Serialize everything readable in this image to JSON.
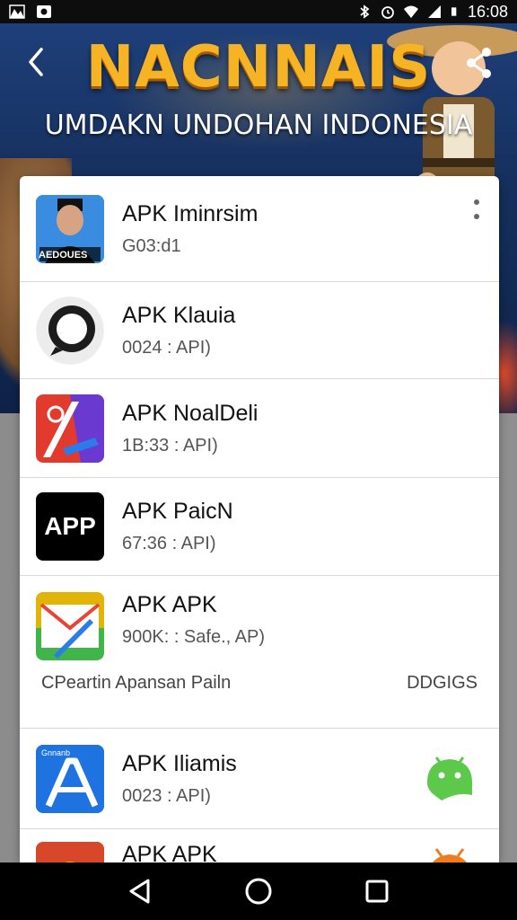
{
  "status_bar": {
    "time": "16:08"
  },
  "banner": {
    "title": "NACNNAIS",
    "subtitle": "UMDAKN UNDOHAN INDONESIA"
  },
  "apps": [
    {
      "name": "APK Iminrsim",
      "meta": "G03:d1",
      "icon_label": "AEDOUES",
      "icon": "person-photo-icon"
    },
    {
      "name": "APK Klauia",
      "meta": "0024 : API)",
      "icon": "chat-bubble-icon"
    },
    {
      "name": "APK NoalDeli",
      "meta": "1B:33 : API)",
      "icon": "maps-style-icon"
    },
    {
      "name": "APK PaicN",
      "meta": "67:36 : API)",
      "icon_label": "APP",
      "icon": "app-text-icon"
    },
    {
      "name": "APK APK",
      "meta": "900K: : Safe., AP)",
      "icon": "nav-envelope-icon"
    },
    {
      "name": "APK Iliamis",
      "meta": "0023 : API)",
      "icon_label": "Gnnanb",
      "icon": "letter-a-icon"
    },
    {
      "name": "APK APK",
      "icon": "red-app-icon"
    }
  ],
  "section": {
    "left": "CPeartin Apansan Pailn",
    "right": "DDGIGS"
  },
  "colors": {
    "banner_title": "#f6b324",
    "card_bg": "#ffffff",
    "android_green": "#5cc94a"
  }
}
